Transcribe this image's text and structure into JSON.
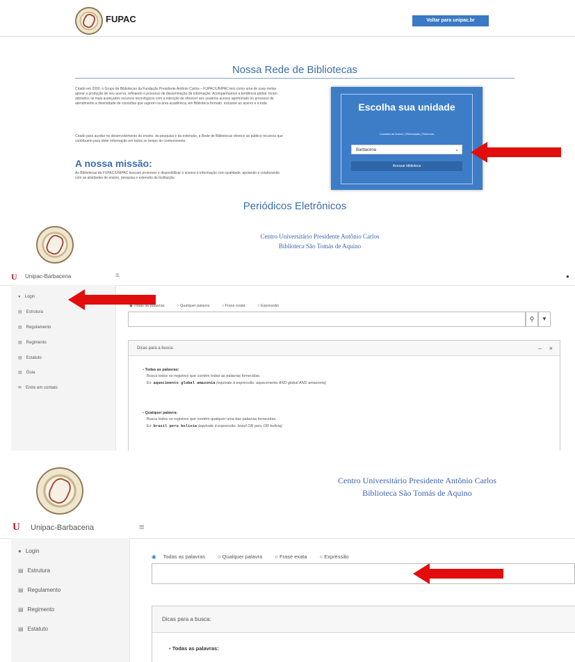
{
  "panel1": {
    "brand": "FUPAC",
    "visit_button": "Voltar para unipac.br",
    "section_title": "Nossa Rede de Bibliotecas",
    "intro_paragraph": "Criado em 2000, o Grupo de Bibliotecas da Fundação Presidente Antônio Carlos – FUPAC/UNIPAC tem como uma de suas metas apoiar a produção de seu acervo, refinando o processo de disseminação da informação. Acompanhamos a tendência global, foram adotados os mais avançados recursos tecnológicos com a intenção de oferecer aos usuários acesso aprimorado no processo de atendimento à diversidade de consultas que suprem na área acadêmica, em Biblioteca formato, inclusive ao acervo e à toda.",
    "second_paragraph": "Criado para auxiliar no desenvolvimento do ensino, da pesquisa e da extensão, a Rede de Bibliotecas oferece ao público recursos que contribuem para obter informação em todos os tempo do conhecimento.",
    "mission_title": "A nossa missão:",
    "mission_paragraph": "As Bibliotecas da FUPAC/UNIPAC buscam promover e disponibilizar o acesso à informação com qualidade, apoiando e colaborando com as atividades de ensino, pesquisa e extensão da Instituição.",
    "unit_card": {
      "title": "Escolha sua unidade",
      "links": "Consulta ao Acervo | Renovação | Reservas",
      "selected_unit": "Barbacena",
      "access_button": "Acessar biblioteca"
    },
    "footer_title": "Periódicos Eletrônicos"
  },
  "institution": {
    "line1": "Centro Universitário Presidente Antônio Carlos",
    "line2": "Biblioteca São Tomás de Aquino"
  },
  "navbar": {
    "logo_letter": "U",
    "brand": "Unipac-Barbacena",
    "menu_icon": "≡",
    "user_icon": "person-icon"
  },
  "sidebar": {
    "items": [
      {
        "label": "Login",
        "icon": "user-icon"
      },
      {
        "label": "Estrutura",
        "icon": "document-icon"
      },
      {
        "label": "Regulamento",
        "icon": "document-icon"
      },
      {
        "label": "Regimento",
        "icon": "document-icon"
      },
      {
        "label": "Estatuto",
        "icon": "document-icon"
      },
      {
        "label": "Guia",
        "icon": "document-icon"
      },
      {
        "label": "Entre em contato",
        "icon": "envelope-icon"
      }
    ]
  },
  "search": {
    "options": [
      "Todas as palavras",
      "Qualquer palavra",
      "Frase exata",
      "Expressão"
    ],
    "selected": "Todas as palavras",
    "input_value": "",
    "search_icon": "search-icon",
    "filter_icon": "filter-icon"
  },
  "tips": {
    "title": "Dicas para a busca:",
    "minimize": "–",
    "close": "×",
    "items": [
      {
        "heading": "Todas as palavras:",
        "desc": "Busca todos os registros que contém todas as palavras fornecidas.",
        "example_prefix": "Ex:",
        "example_code": "aquecimento global amazonia",
        "example_note": "(equivale à expressão: aquecimento AND global AND amazonia)"
      },
      {
        "heading": "Qualquer palavra:",
        "desc": "Busca todos os registros que contém qualquer uma das palavras fornecidas.",
        "example_prefix": "Ex:",
        "example_code": "brasil peru bolivia",
        "example_note": "(equivale à expressão: brasil OR peru OR bolivia)"
      }
    ]
  },
  "colors": {
    "accent_blue": "#3d7dc8",
    "institution_blue": "#3f63b0",
    "arrow_red": "#e20d0d",
    "logo_red": "#c0182b"
  }
}
